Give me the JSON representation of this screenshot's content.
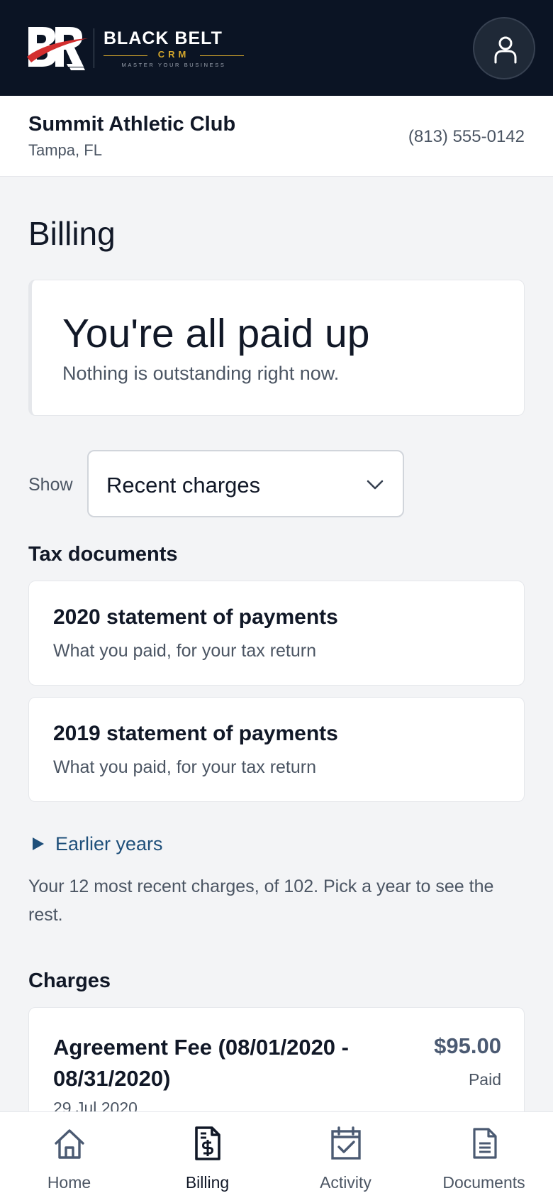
{
  "header": {
    "brand": {
      "name": "BLACK BELT",
      "crm": "CRM",
      "tagline": "MASTER YOUR BUSINESS"
    },
    "icons": {
      "logo": "bb-logo-mark",
      "profile": "user-icon"
    }
  },
  "club": {
    "name": "Summit Athletic Club",
    "location": "Tampa, FL",
    "phone": "(813) 555-0142"
  },
  "page": {
    "title": "Billing"
  },
  "status_card": {
    "title": "You're all paid up",
    "subtitle": "Nothing is outstanding right now."
  },
  "filter": {
    "label": "Show",
    "selected": "Recent charges"
  },
  "tax_documents": {
    "heading": "Tax documents",
    "items": [
      {
        "title": "2020 statement of payments",
        "subtitle": "What you paid, for your tax return"
      },
      {
        "title": "2019 statement of payments",
        "subtitle": "What you paid, for your tax return"
      }
    ],
    "earlier_label": "Earlier years"
  },
  "summary_note": "Your 12 most recent charges, of 102. Pick a year to see the rest.",
  "charges": {
    "heading": "Charges",
    "items": [
      {
        "title": "Agreement Fee (08/01/2020 - 08/31/2020)",
        "amount": "$95.00",
        "status": "Paid",
        "date": "29 Jul 2020"
      }
    ]
  },
  "bottom_nav": {
    "active": "Billing",
    "items": [
      {
        "label": "Home",
        "icon": "home-icon"
      },
      {
        "label": "Billing",
        "icon": "invoice-dollar-icon"
      },
      {
        "label": "Activity",
        "icon": "calendar-check-icon"
      },
      {
        "label": "Documents",
        "icon": "document-icon"
      }
    ]
  },
  "colors": {
    "header_bg": "#0b1424",
    "brand_gold": "#d4a72c",
    "brand_red": "#d32f2f",
    "link": "#1e4f7a",
    "amount": "#4b5a72",
    "page_bg": "#f3f4f6"
  }
}
